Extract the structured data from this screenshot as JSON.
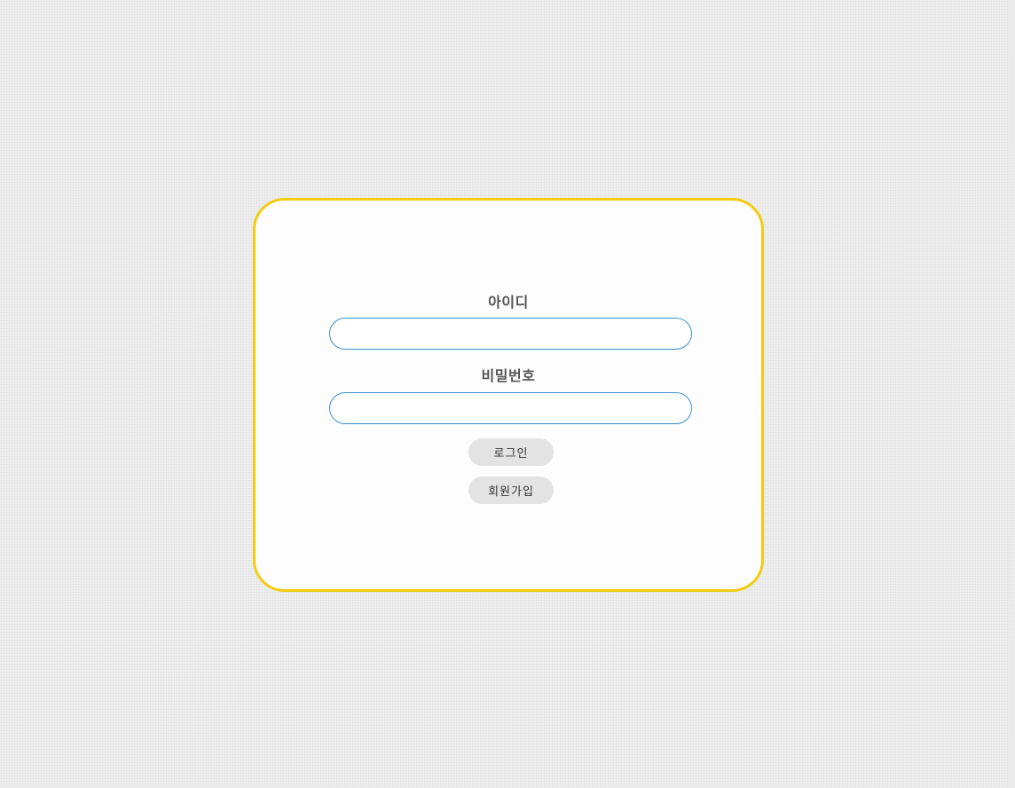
{
  "login_form": {
    "id_label": "아이디",
    "id_value": "",
    "password_label": "비밀번호",
    "password_value": "",
    "login_button": "로그인",
    "signup_button": "회원가입"
  },
  "colors": {
    "card_border": "#f2cc10",
    "input_border": "#3a8fd0",
    "button_bg": "#e3e3e3",
    "page_bg": "#ececec"
  }
}
